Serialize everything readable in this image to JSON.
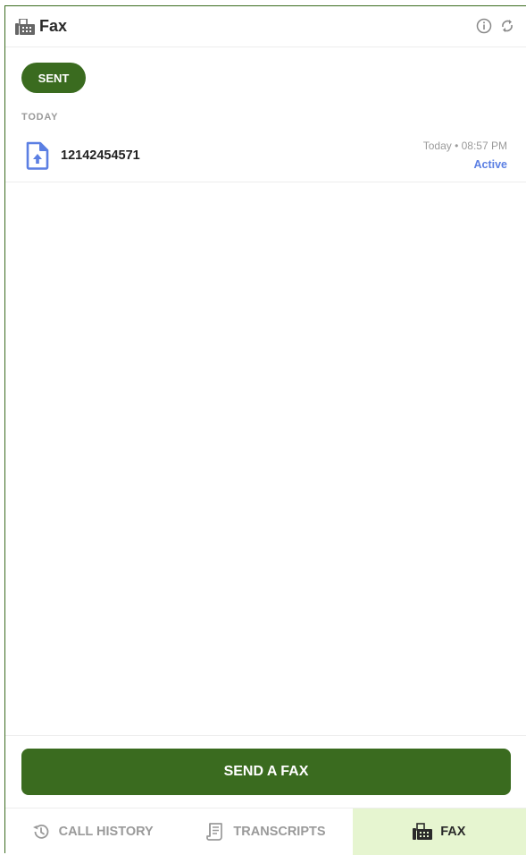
{
  "header": {
    "title": "Fax",
    "icon": "fax-icon",
    "actions": [
      "info-icon",
      "refresh-icon"
    ]
  },
  "filter": {
    "label": "SENT"
  },
  "section": {
    "label": "TODAY"
  },
  "fax_items": [
    {
      "number": "12142454571",
      "time": "Today • 08:57 PM",
      "status": "Active",
      "icon": "upload-document-icon"
    }
  ],
  "send_button": {
    "label": "SEND A FAX"
  },
  "tabs": [
    {
      "label": "CALL HISTORY",
      "icon": "history-icon",
      "active": false
    },
    {
      "label": "TRANSCRIPTS",
      "icon": "transcript-icon",
      "active": false
    },
    {
      "label": "FAX",
      "icon": "fax-icon",
      "active": true
    }
  ],
  "colors": {
    "brand_green": "#3a6b1f",
    "active_tab_bg": "#e6f5d0",
    "status_blue": "#5b7fe3",
    "muted_text": "#9a9a9a"
  }
}
